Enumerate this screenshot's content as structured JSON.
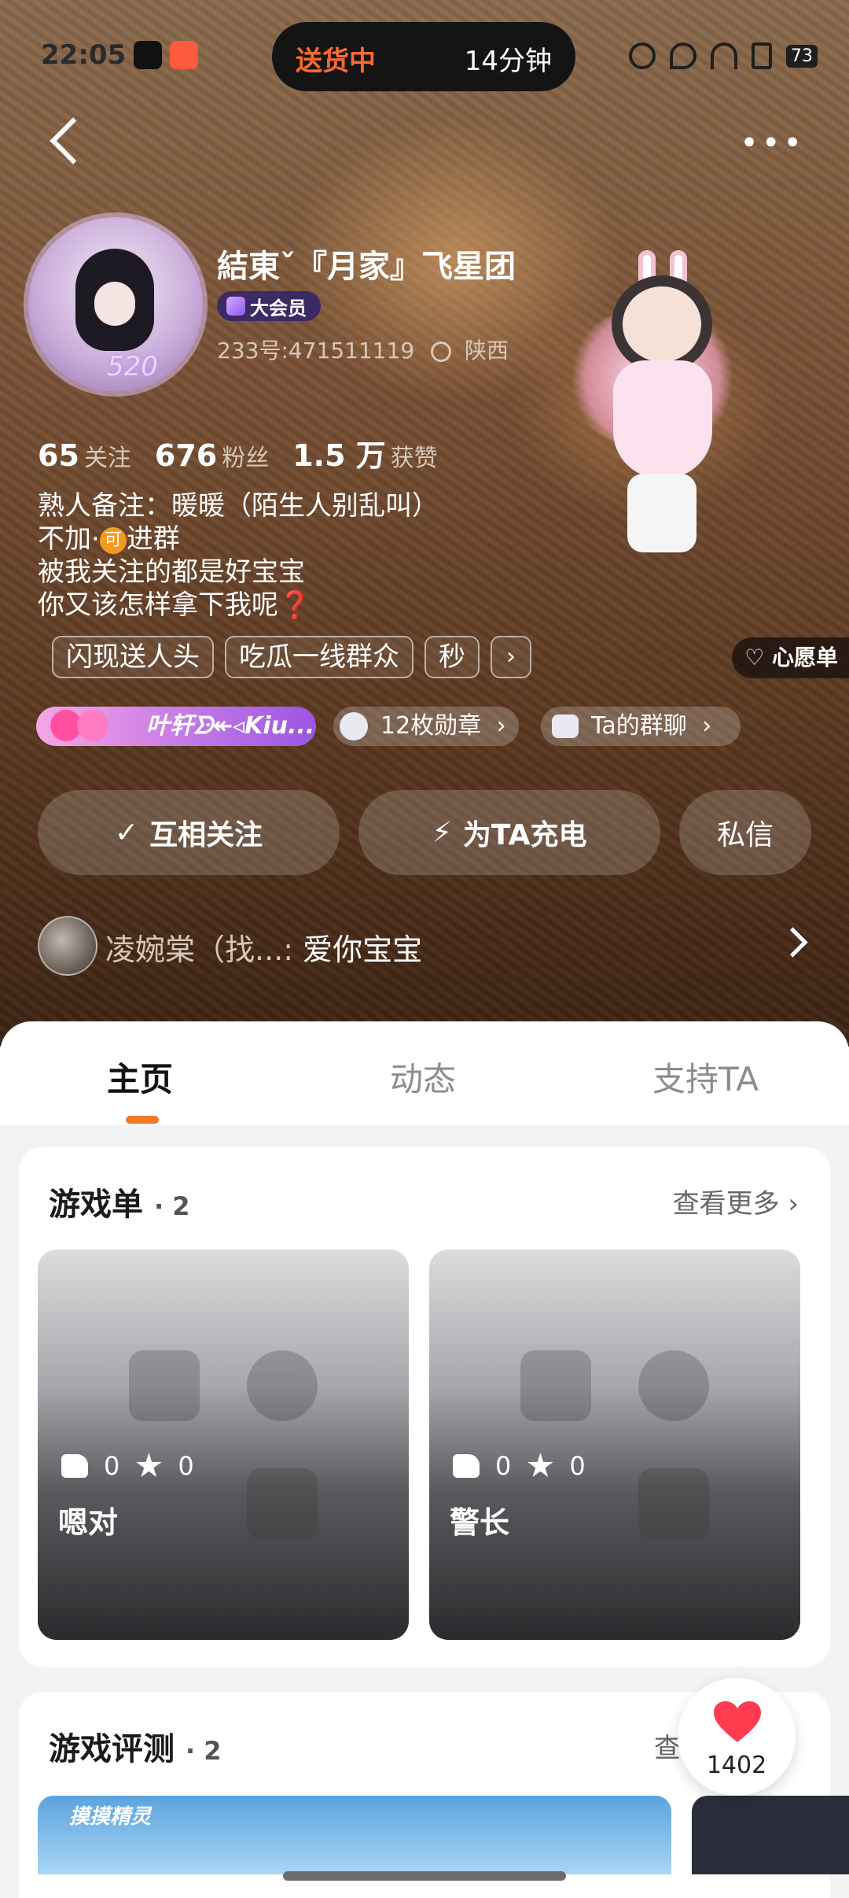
{
  "status_bar": {
    "time": "22:05",
    "pill_left": "送货中",
    "pill_right": "14分钟",
    "battery": "73"
  },
  "profile": {
    "name": "結東ˇ『月家』飞星团",
    "vip_label": "大会员",
    "uid_line": "233号:471511119",
    "location": "陕西",
    "avatar_text": "520",
    "stats": {
      "follow_count": "65",
      "follow_label": "关注",
      "fans_count": "676",
      "fans_label": "粉丝",
      "likes_count": "1.5 万",
      "likes_label": "获赞"
    },
    "bio": {
      "line1": "熟人备注：暖暖（陌生人别乱叫）",
      "line2_prefix": "不加·",
      "line2_coin": "可",
      "line2_suffix": "进群",
      "line3": "被我关注的都是好宝宝",
      "line4": "你又该怎样拿下我呢",
      "line4_mark": "❓"
    },
    "tags": [
      "闪现送人头",
      "吃瓜一线群众",
      "秒"
    ],
    "tag_more": "›",
    "wishlist_label": "心愿单",
    "fan_chip": "叶轩ᗦ↞◃Kiu...",
    "medal_chip": "12枚勋章",
    "group_chip": "Ta的群聊",
    "chip_arrow": "›"
  },
  "actions": {
    "follow_label": "互相关注",
    "follow_check": "✓",
    "charge_label": "为TA充电",
    "charge_icon": "⚡",
    "dm_label": "私信"
  },
  "visitor": {
    "name": "凌婉棠（找...",
    "separator": ":",
    "message": "爱你宝宝"
  },
  "tabs": [
    "主页",
    "动态",
    "支持TA"
  ],
  "game_list": {
    "title": "游戏单",
    "count": "· 2",
    "see_more": "查看更多 ›",
    "items": [
      {
        "name": "嗯对",
        "likes": "0",
        "stars": "0"
      },
      {
        "name": "警长",
        "likes": "0",
        "stars": "0"
      }
    ]
  },
  "reviews": {
    "title": "游戏评测",
    "count": "· 2",
    "see_more_partial": "查",
    "banner_text": "摸摸精灵"
  },
  "like_fab": {
    "count": "1402"
  },
  "colors": {
    "accent": "#f07826",
    "vip": "#3b2a63",
    "heart": "#ff3b4f"
  }
}
